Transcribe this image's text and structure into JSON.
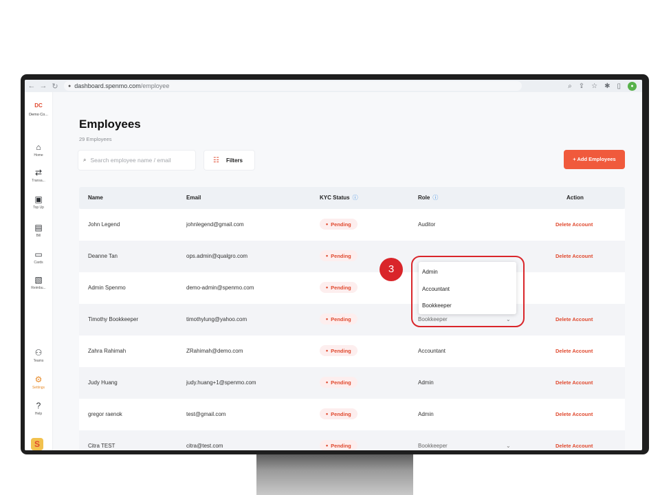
{
  "browser": {
    "url_host": "dashboard.spenmo.com",
    "url_path": "/employee"
  },
  "org": {
    "badge": "DC",
    "name": "Demo Co..."
  },
  "sidebar": {
    "items": [
      {
        "label": "Home",
        "icon": "home-icon"
      },
      {
        "label": "Transa...",
        "icon": "transactions-icon"
      },
      {
        "label": "Top Up",
        "icon": "topup-icon"
      },
      {
        "label": "Bill",
        "icon": "bill-icon"
      },
      {
        "label": "Cards",
        "icon": "card-icon"
      },
      {
        "label": "Reimbu...",
        "icon": "reimbursement-icon"
      },
      {
        "label": "Teams",
        "icon": "teams-icon"
      },
      {
        "label": "Settings",
        "icon": "gear-icon",
        "active": true
      },
      {
        "label": "Help",
        "icon": "help-icon"
      }
    ]
  },
  "page": {
    "title": "Employees",
    "count": "29 Employees",
    "search_placeholder": "Search employee name / email",
    "filters_label": "Filters",
    "add_label": "+ Add Employees"
  },
  "table": {
    "headers": {
      "name": "Name",
      "email": "Email",
      "kyc": "KYC Status",
      "role": "Role",
      "action": "Action"
    },
    "rows": [
      {
        "name": "John Legend",
        "email": "johnlegend@gmail.com",
        "kyc": "Pending",
        "role": "Auditor",
        "action": "Delete Account"
      },
      {
        "name": "Deanne Tan",
        "email": "ops.admin@qualgro.com",
        "kyc": "Pending",
        "role": "",
        "action": "Delete Account"
      },
      {
        "name": "Admin Spenmo",
        "email": "demo-admin@spenmo.com",
        "kyc": "Pending",
        "role": "",
        "action": ""
      },
      {
        "name": "Timothy Bookkeeper",
        "email": "timothylung@yahoo.com",
        "kyc": "Pending",
        "role": "Bookkeeper",
        "action": "Delete Account"
      },
      {
        "name": "Zahra Rahimah",
        "email": "ZRahimah@demo.com",
        "kyc": "Pending",
        "role": "Accountant",
        "action": "Delete Account"
      },
      {
        "name": "Judy Huang",
        "email": "judy.huang+1@spenmo.com",
        "kyc": "Pending",
        "role": "Admin",
        "action": "Delete Account"
      },
      {
        "name": "gregor raenok",
        "email": "test@gmail.com",
        "kyc": "Pending",
        "role": "Admin",
        "action": "Delete Account"
      },
      {
        "name": "Citra TEST",
        "email": "citra@test.com",
        "kyc": "Pending",
        "role": "Bookkeeper",
        "action": "Delete Account"
      }
    ]
  },
  "role_dropdown": {
    "options": [
      "Admin",
      "Accountant",
      "Bookkeeper"
    ]
  },
  "annotation": {
    "step": "3"
  }
}
